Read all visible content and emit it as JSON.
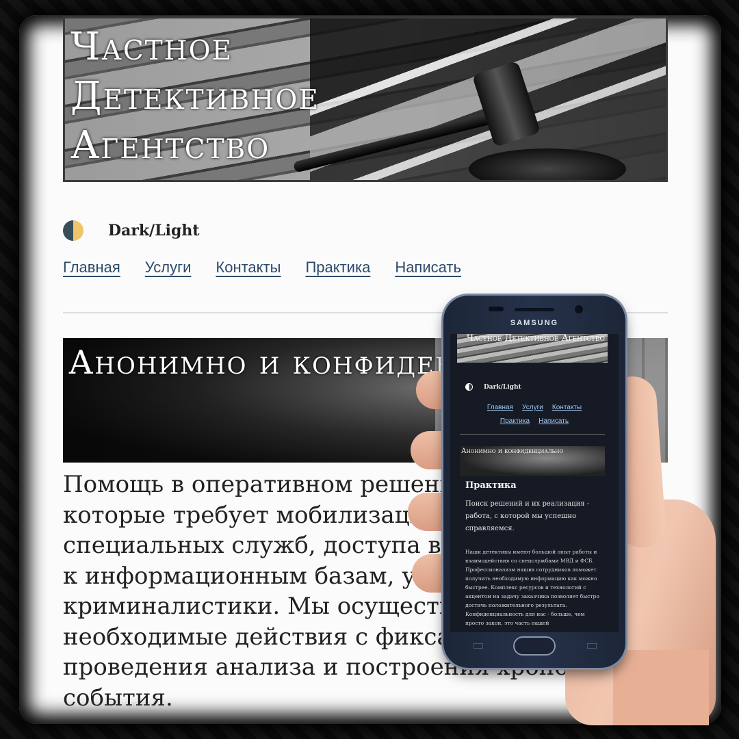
{
  "site": {
    "hero_title": "Частное Детективное Агентство",
    "theme_toggle_label": "Dark/Light",
    "nav": [
      "Главная",
      "Услуги",
      "Контакты",
      "Практика",
      "Написать"
    ],
    "banner_title": "Анонимно и конфиденциально",
    "body_text": "Помощь в оперативном решении вопросов, которые требует мобилизации ресурсов, специальных служб, доступа в частном порядке к информационным базам, услугам и криминалистики. Мы осуществляем необходимые действия с фиксацией следов для проведения анализа и построения хронологии события."
  },
  "phone": {
    "brand": "SAMSUNG",
    "hero_title": "Частное Детективное Агентство",
    "theme_toggle_label": "Dark/Light",
    "nav": [
      "Главная",
      "Услуги",
      "Контакты",
      "Практика",
      "Написать"
    ],
    "banner_title": "Анонимно и конфиденциально",
    "heading": "Практика",
    "lead": "Поиск решений и их реализация - работа, с которой мы успешно справляемся.",
    "body": "Наши детективы имеют большой опыт работы и взаимодействия со спецслужбами МВД и ФСБ. Профессионализм наших сотрудников поможет получить необходимую информацию как можно быстрее. Комплекс ресурсов и технологий с акцентом на задачу заказчика позволяет быстро достичь положительного результата. Конфиденциальность для нас - больше, чем просто закон, это часть нашей"
  },
  "colors": {
    "page_background": "#fbfbfb",
    "link": "#2c4a6a",
    "phone_screen": "#161a24",
    "phone_link": "#9ec4ef",
    "toggle_dark": "#3a4d5a",
    "toggle_light": "#f0c46a"
  }
}
